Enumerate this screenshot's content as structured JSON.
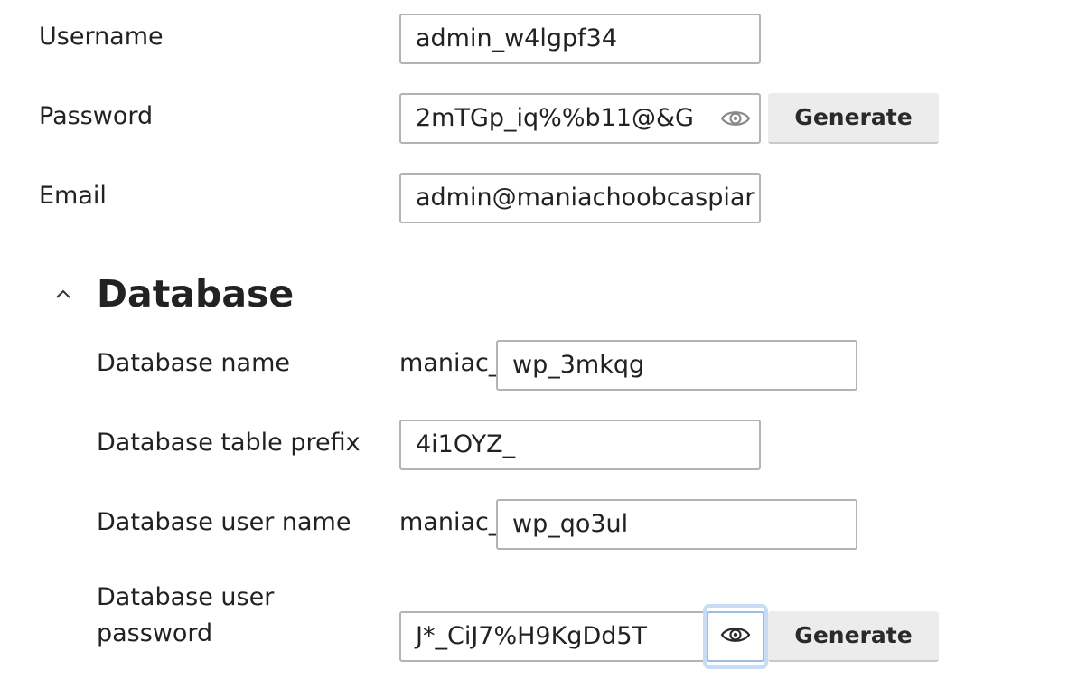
{
  "admin": {
    "username": {
      "label": "Username",
      "value": "admin_w4lgpf34"
    },
    "password": {
      "label": "Password",
      "value": "2mTGp_iq%%b11@&G",
      "generate_label": "Generate"
    },
    "email": {
      "label": "Email",
      "value": "admin@maniachoobcaspiar"
    }
  },
  "database": {
    "section_title": "Database",
    "name": {
      "label": "Database name",
      "prefix": "maniac_",
      "value": "wp_3mkqg"
    },
    "table_prefix": {
      "label": "Database table prefix",
      "value": "4i1OYZ_"
    },
    "user_name": {
      "label": "Database user name",
      "prefix": "maniac_",
      "value": "wp_qo3ul"
    },
    "user_password": {
      "label_line1": "Database user",
      "label_line2": "password",
      "value": "J*_CiJ7%H9KgDd5T",
      "generate_label": "Generate"
    }
  },
  "icons": {
    "show_password": "eye-icon",
    "collapse": "chevron-up-icon"
  },
  "colors": {
    "focus_ring": "#c8dcf5",
    "button_bg": "#ececec"
  }
}
